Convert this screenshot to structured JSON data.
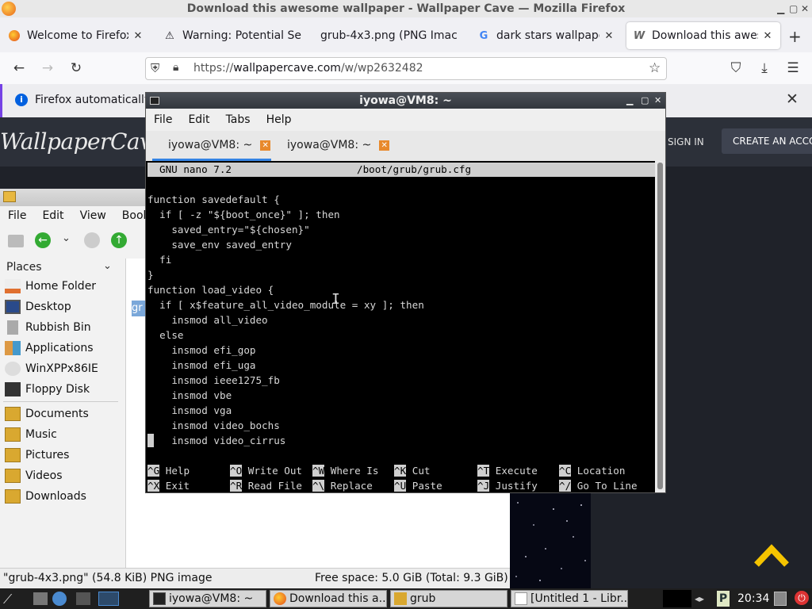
{
  "firefox": {
    "window_title": "Download this awesome wallpaper - Wallpaper Cave — Mozilla Firefox",
    "tabs": [
      {
        "label": "Welcome to Firefox"
      },
      {
        "label": "Warning: Potential Se"
      },
      {
        "label": "grub-4x3.png (PNG Imac"
      },
      {
        "label": "dark stars wallpaper"
      },
      {
        "label": "Download this aweso"
      }
    ],
    "url_prefix": "https://",
    "url_domain": "wallpapercave.com",
    "url_path": "/w/wp2632482",
    "notification_text": "Firefox automatically",
    "site": {
      "logo": "WallpaperCave",
      "sign_in": "SIGN IN",
      "create_account": "CREATE AN ACCOUNT"
    }
  },
  "file_manager": {
    "menu": [
      "File",
      "Edit",
      "View",
      "Bookma"
    ],
    "places_header": "Places",
    "places": [
      {
        "label": "Home Folder",
        "icon": "home-icon"
      },
      {
        "label": "Desktop",
        "icon": "desktop-icon"
      },
      {
        "label": "Rubbish Bin",
        "icon": "trash-icon"
      },
      {
        "label": "Applications",
        "icon": "applications-icon"
      },
      {
        "label": "WinXPPx86IE",
        "icon": "drive-icon"
      },
      {
        "label": "Floppy Disk",
        "icon": "floppy-icon"
      }
    ],
    "bookmarks": [
      {
        "label": "Documents"
      },
      {
        "label": "Music"
      },
      {
        "label": "Pictures"
      },
      {
        "label": "Videos"
      },
      {
        "label": "Downloads"
      }
    ],
    "selected_item_fragment": "gr",
    "status_left": "\"grub-4x3.png\" (54.8 KiB) PNG image",
    "status_right": "Free space: 5.0 GiB (Total: 9.3 GiB)"
  },
  "terminal": {
    "title": "iyowa@VM8: ~",
    "menu": [
      "File",
      "Edit",
      "Tabs",
      "Help"
    ],
    "tabs": [
      {
        "label": "iyowa@VM8: ~"
      },
      {
        "label": "iyowa@VM8: ~"
      }
    ],
    "nano_version": "GNU nano 7.2",
    "nano_file": "/boot/grub/grub.cfg",
    "lines": [
      "function savedefault {",
      "  if [ -z \"${boot_once}\" ]; then",
      "    saved_entry=\"${chosen}\"",
      "    save_env saved_entry",
      "  fi",
      "}",
      "function load_video {",
      "  if [ x$feature_all_video_module = xy ]; then",
      "    insmod all_video",
      "  else",
      "    insmod efi_gop",
      "    insmod efi_uga",
      "    insmod ieee1275_fb",
      "    insmod vbe",
      "    insmod vga",
      "    insmod video_bochs",
      "    insmod video_cirrus"
    ],
    "shortcuts_row1": [
      {
        "key": "^G",
        "label": "Help"
      },
      {
        "key": "^O",
        "label": "Write Out"
      },
      {
        "key": "^W",
        "label": "Where Is"
      },
      {
        "key": "^K",
        "label": "Cut"
      },
      {
        "key": "^T",
        "label": "Execute"
      },
      {
        "key": "^C",
        "label": "Location"
      }
    ],
    "shortcuts_row2": [
      {
        "key": "^X",
        "label": "Exit"
      },
      {
        "key": "^R",
        "label": "Read File"
      },
      {
        "key": "^\\",
        "label": "Replace"
      },
      {
        "key": "^U",
        "label": "Paste"
      },
      {
        "key": "^J",
        "label": "Justify"
      },
      {
        "key": "^/",
        "label": "Go To Line"
      }
    ]
  },
  "taskbar": {
    "buttons": [
      {
        "label": "iyowa@VM8: ~"
      },
      {
        "label": "Download this a..."
      },
      {
        "label": "grub"
      },
      {
        "label": "[Untitled 1 - Libr..."
      }
    ],
    "clock": "20:34"
  },
  "colors": {
    "accent_blue": "#3584e4",
    "site_dark": "#2c3039",
    "arrow_yellow": "#f5c400"
  }
}
